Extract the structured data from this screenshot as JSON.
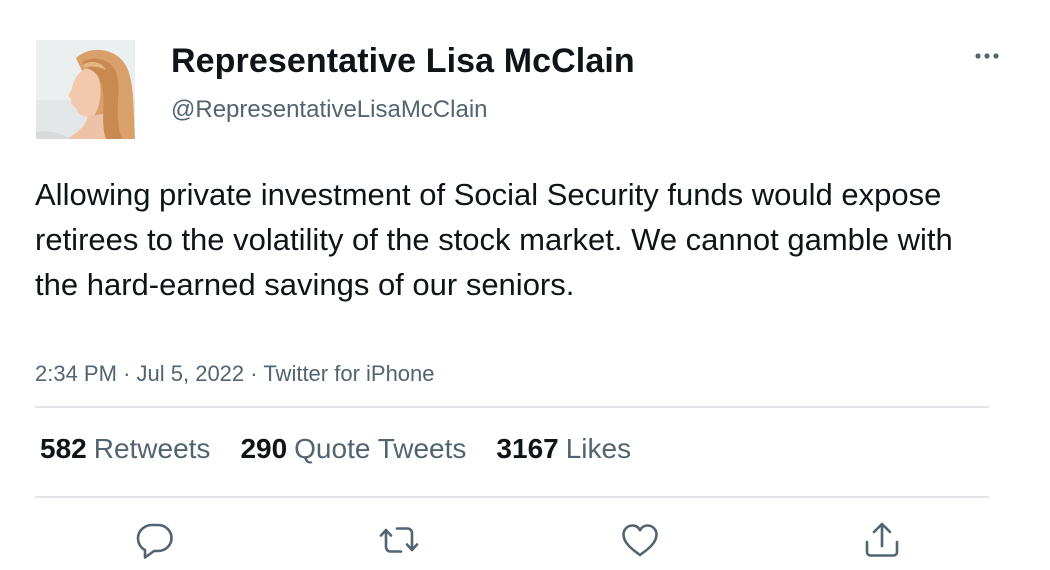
{
  "author": {
    "display_name": "Representative Lisa McClain",
    "handle": "@RepresentativeLisaMcClain",
    "avatar_icon": "profile-photo"
  },
  "tweet": {
    "text": "Allowing private investment of Social Security funds would expose retirees to the volatility of the stock market. We cannot gamble with the hard-earned savings of our seniors.",
    "time": "2:34 PM",
    "separator": "·",
    "date": "Jul 5, 2022",
    "source": "Twitter for iPhone"
  },
  "stats": {
    "retweets_count": "582",
    "retweets_label": "Retweets",
    "quotes_count": "290",
    "quotes_label": "Quote Tweets",
    "likes_count": "3167",
    "likes_label": "Likes"
  },
  "actions": {
    "reply_icon": "reply-icon",
    "retweet_icon": "retweet-icon",
    "like_icon": "heart-icon",
    "share_icon": "share-icon",
    "more_icon": "more-icon"
  },
  "colors": {
    "text_primary": "#0f1419",
    "text_secondary": "#536471",
    "divider": "#e1e5e8",
    "icon": "#536471"
  }
}
